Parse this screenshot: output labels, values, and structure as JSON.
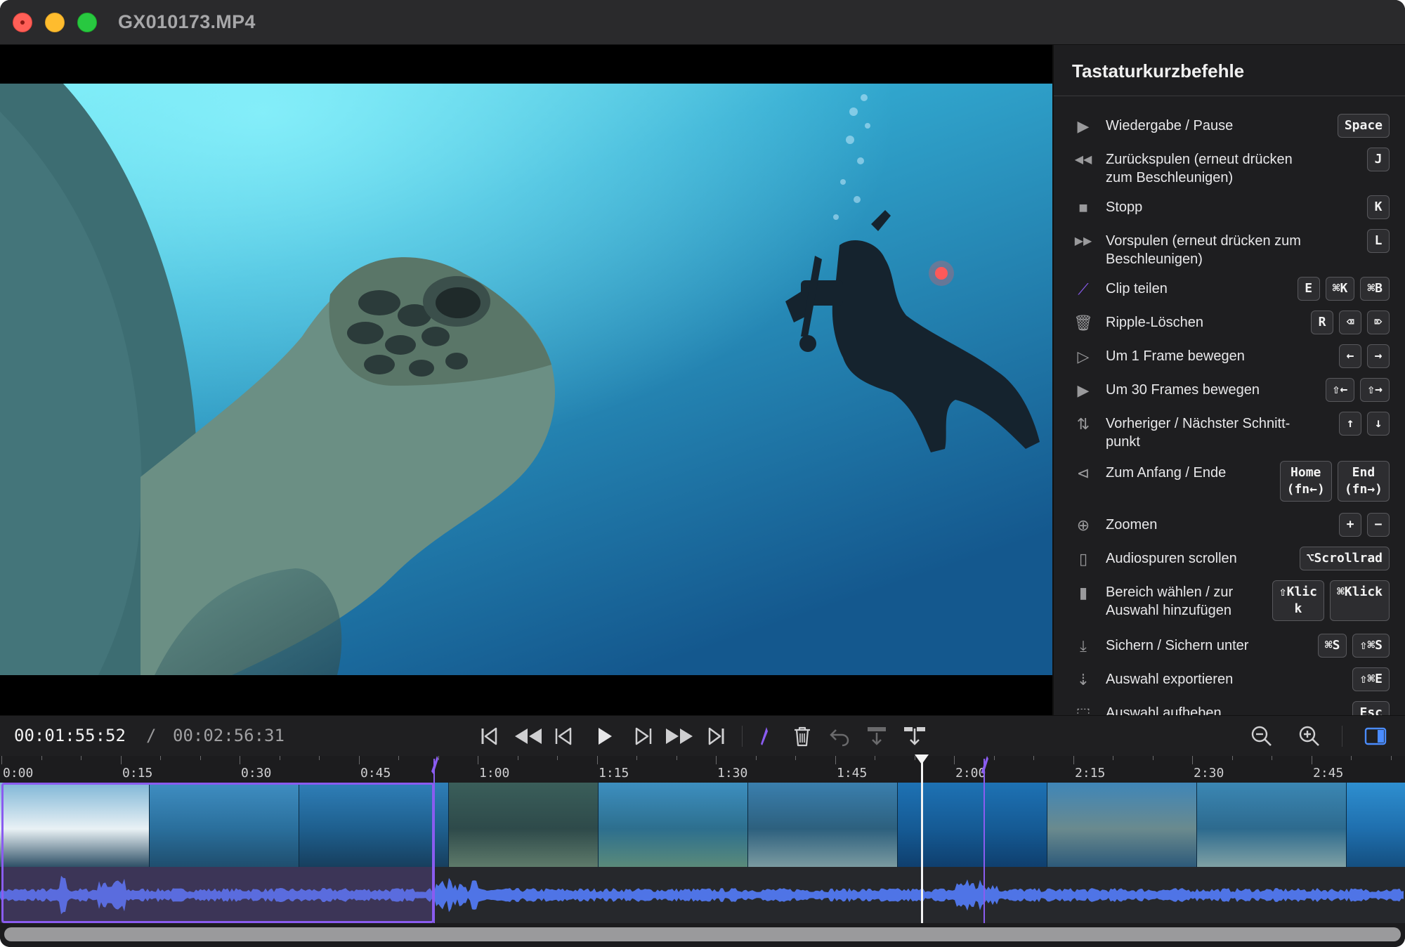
{
  "window": {
    "title": "GX010173.MP4"
  },
  "panel": {
    "title": "Tastaturkurzbefehle",
    "shortcuts": [
      {
        "icon": "play-icon",
        "label": "Wiedergabe / Pause",
        "keys": [
          "Space"
        ]
      },
      {
        "icon": "rewind-icon",
        "label": "Zurückspulen (erneut drücken zum Beschleunigen)",
        "keys": [
          "J"
        ]
      },
      {
        "icon": "stop-icon",
        "label": "Stopp",
        "keys": [
          "K"
        ]
      },
      {
        "icon": "fast-forward-icon",
        "label": "Vorspulen (erneut drücken zum Beschleunigen)",
        "keys": [
          "L"
        ]
      },
      {
        "icon": "split-clip-icon",
        "label": "Clip teilen",
        "keys": [
          "E",
          "⌘K",
          "⌘B"
        ]
      },
      {
        "icon": "trash-icon",
        "label": "Ripple-Löschen",
        "keys": [
          "R",
          "⌫",
          "⌦"
        ]
      },
      {
        "icon": "frame-step-icon",
        "label": "Um 1 Frame bewegen",
        "keys": [
          "←",
          "→"
        ]
      },
      {
        "icon": "frame-step-30-icon",
        "label": "Um 30 Frames bewegen",
        "keys": [
          "⇧←",
          "⇧→"
        ]
      },
      {
        "icon": "up-down-arrows-icon",
        "label": "Vorheriger / Nächster Schnitt-punkt",
        "keys": [
          "↑",
          "↓"
        ]
      },
      {
        "icon": "skip-to-start-icon",
        "label": "Zum Anfang / Ende",
        "keys": [
          "Home\n(fn←)",
          "End\n(fn→)"
        ]
      },
      {
        "icon": "zoom-icon",
        "label": "Zoomen",
        "keys": [
          "+",
          "−"
        ]
      },
      {
        "icon": "mouse-icon",
        "label": "Audiospuren scrollen",
        "keys": [
          "⌥Scrollrad"
        ]
      },
      {
        "icon": "mouse-click-icon",
        "label": "Bereich wählen / zur Auswahl hinzufügen",
        "keys": [
          "⇧Klic\nk",
          "⌘Klick"
        ]
      },
      {
        "icon": "save-icon",
        "label": "Sichern / Sichern unter",
        "keys": [
          "⌘S",
          "⇧⌘S"
        ]
      },
      {
        "icon": "export-icon",
        "label": "Auswahl exportieren",
        "keys": [
          "⇧⌘E"
        ]
      },
      {
        "icon": "deselect-icon",
        "label": "Auswahl aufheben",
        "keys": [
          "Esc"
        ]
      }
    ]
  },
  "transport": {
    "current_time": "00:01:55:52",
    "separator": "/",
    "total_time": "00:02:56:31"
  },
  "ruler": {
    "labels": [
      "0:00",
      "0:15",
      "0:30",
      "0:45",
      "1:00",
      "1:15",
      "1:30",
      "1:45",
      "2:00",
      "2:15",
      "2:30",
      "2:45"
    ]
  },
  "colors": {
    "accent": "#8a5cf0",
    "waveform": "#4f74e6",
    "background": "#1c1c1e"
  }
}
